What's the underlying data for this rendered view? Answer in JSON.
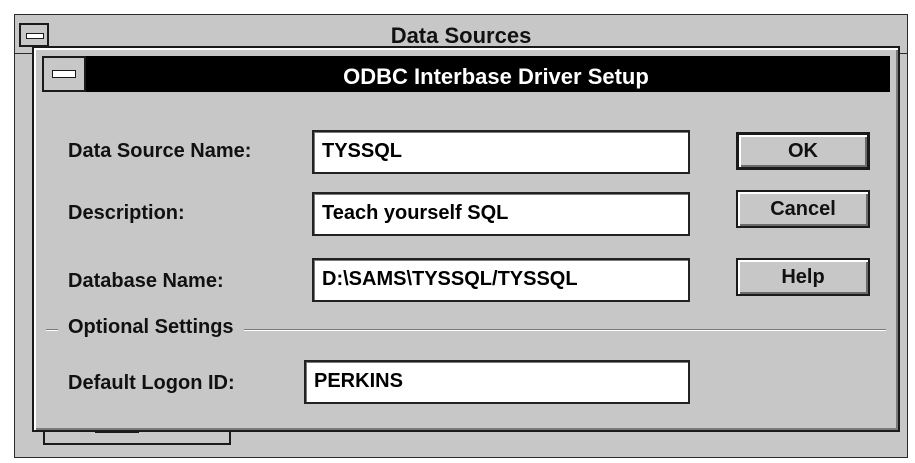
{
  "background_window": {
    "title": "Data Sources"
  },
  "dialog": {
    "title": "ODBC Interbase Driver Setup",
    "fields": {
      "data_source_name": {
        "label": "Data Source Name:",
        "value": "TYSSQL"
      },
      "description": {
        "label": "Description:",
        "value": "Teach yourself SQL"
      },
      "database_name": {
        "label": "Database Name:",
        "value": "D:\\SAMS\\TYSSQL/TYSSQL"
      },
      "default_logon_id": {
        "label": "Default Logon ID:",
        "value": "PERKINS"
      }
    },
    "optional_settings_label": "Optional Settings",
    "buttons": {
      "ok": "OK",
      "cancel": "Cancel",
      "help": "Help"
    }
  },
  "colors": {
    "window_bg": "#c7c7c7",
    "title_active": "#000000",
    "title_text_active": "#ffffff",
    "field_bg": "#ffffff"
  },
  "icons": {
    "system_menu": "system-menu-icon"
  }
}
